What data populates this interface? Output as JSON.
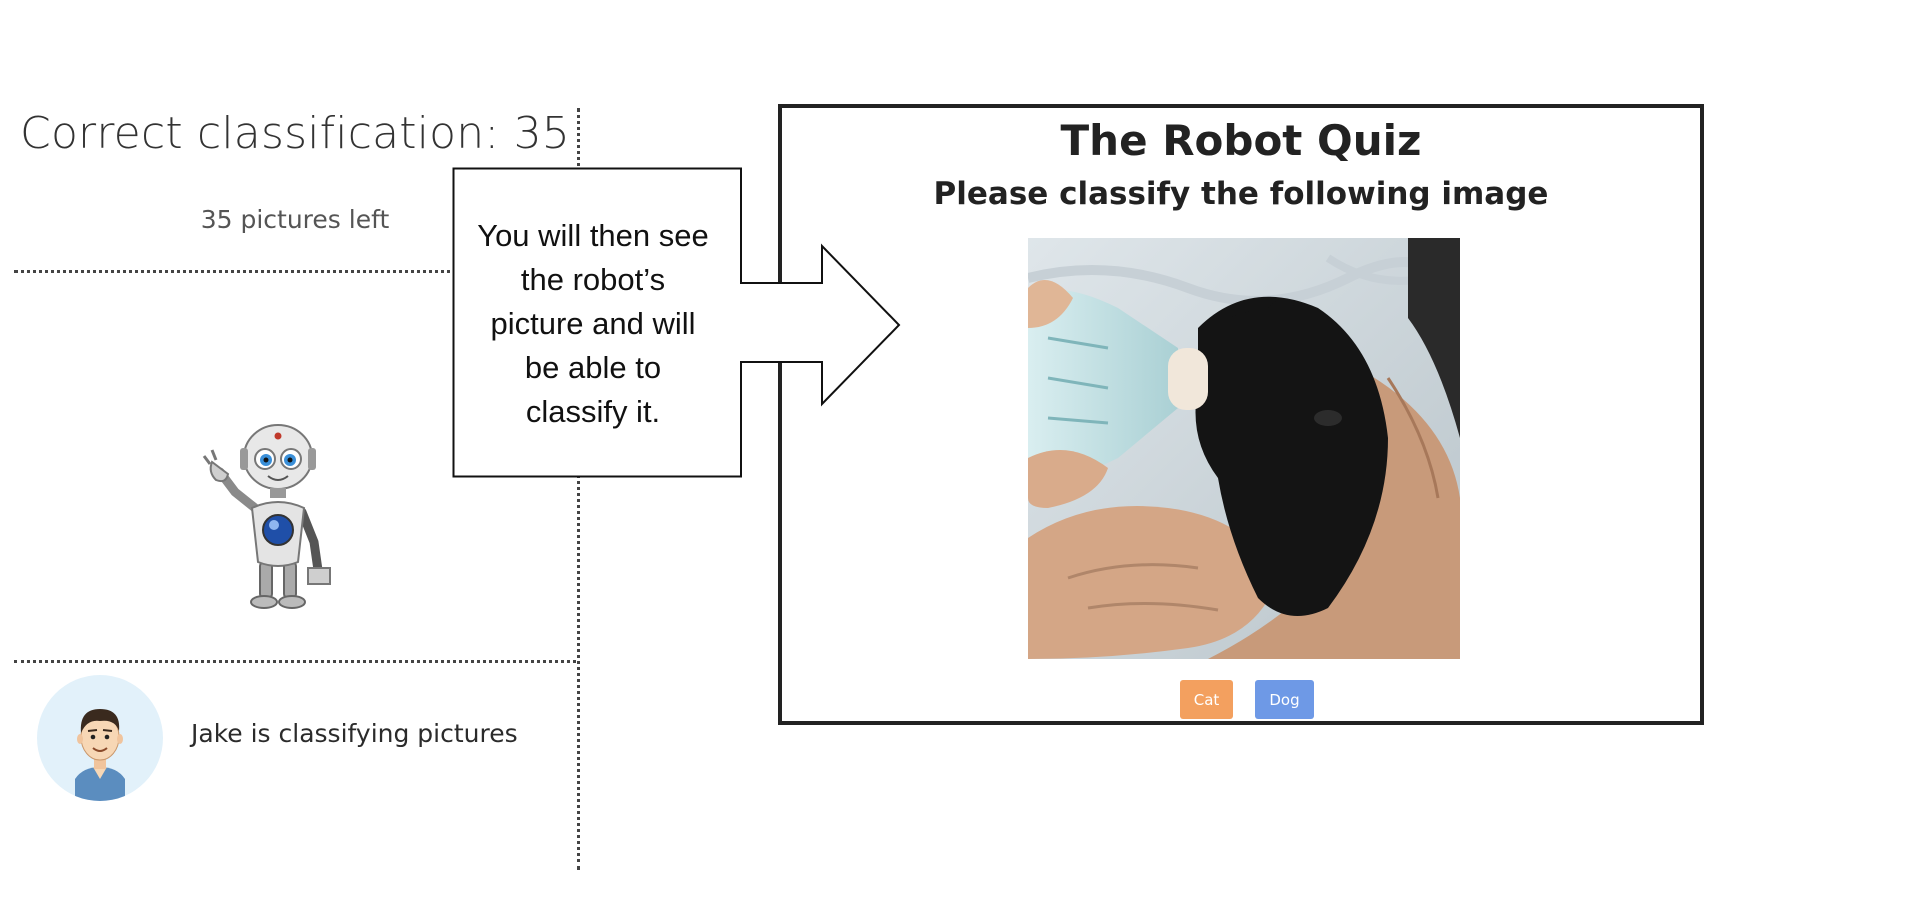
{
  "status": {
    "score_text": "Correct classification: 35",
    "remaining_text": "35 pictures left"
  },
  "player": {
    "status_text": "Jake is classifying pictures"
  },
  "callout": {
    "lines": [
      "You will then see",
      "the robot’s",
      "picture and will",
      "be able to",
      "classify it."
    ]
  },
  "quiz": {
    "title": "The Robot Quiz",
    "subtitle": "Please classify the following image",
    "buttons": [
      {
        "label": "Cat",
        "color": "#f3a05f"
      },
      {
        "label": "Dog",
        "color": "#6e99e6"
      }
    ]
  },
  "icons": {
    "robot": "robot-mascot-icon",
    "avatar": "person-avatar-icon",
    "arrow": "right-arrow-callout"
  }
}
